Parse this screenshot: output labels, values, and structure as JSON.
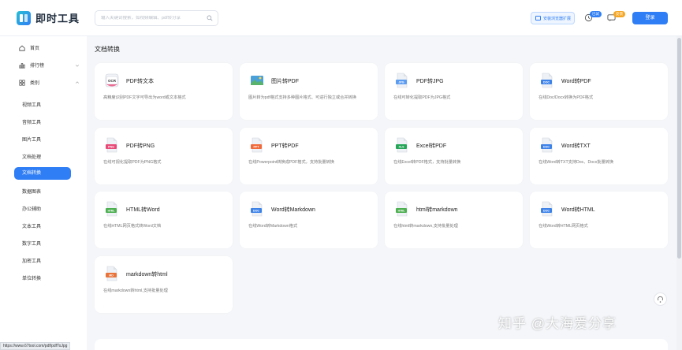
{
  "header": {
    "logo_text": "即时工具",
    "search_placeholder": "输入关键词搜索，如视频编辑、pdf转分享",
    "ext_button": "安装浏览器扩展",
    "badge_1": "已试",
    "badge_2": "反馈",
    "login": "登录"
  },
  "sidebar": {
    "home": "首页",
    "ranking": "排行榜",
    "categories": "类别",
    "sub": [
      "视频工具",
      "音频工具",
      "图片工具",
      "文档处理",
      "文档转换",
      "数据图表",
      "办公辅助",
      "文本工具",
      "数字工具",
      "加密工具",
      "单位转换"
    ],
    "active_index": 4
  },
  "section": {
    "title": "文档转换"
  },
  "cards": [
    {
      "title": "PDF转文本",
      "desc": "高精度识别PDF文字可导出为word或文本格式",
      "icon": "ocr"
    },
    {
      "title": "图片转PDF",
      "desc": "图片转为pdf格式支持多种图片格式、可进行独立或合并转换",
      "icon": "image"
    },
    {
      "title": "PDF转JPG",
      "desc": "在线可转化提取PDF为JPG格式",
      "icon": "JPG"
    },
    {
      "title": "Word转PDF",
      "desc": "在线Doc/Docx转换为PDF格式",
      "icon": "DOC"
    },
    {
      "title": "PDF转PNG",
      "desc": "在线可视化提取PDF为PNG格式",
      "icon": "PNG"
    },
    {
      "title": "PPT转PDF",
      "desc": "在线Powerpoint转换成PDF格式，支持批量转换",
      "icon": "PPT"
    },
    {
      "title": "Excel转PDF",
      "desc": "在线Excel转PDF格式，支持批量转换",
      "icon": "XLS"
    },
    {
      "title": "Word转TXT",
      "desc": "在线Word转TXT支持Doc、Docx批量转换",
      "icon": "DOC"
    },
    {
      "title": "HTML转Word",
      "desc": "在线HTML网页格式转Word文档",
      "icon": "HTML"
    },
    {
      "title": "Word转Markdown",
      "desc": "在线Word转Markdown格式",
      "icon": "DOC"
    },
    {
      "title": "html转markdown",
      "desc": "在线html转markdown,支持批量处理",
      "icon": "HTML"
    },
    {
      "title": "Word转HTML",
      "desc": "在线Word转HTML网页格式",
      "icon": "DOC"
    },
    {
      "title": "markdown转html",
      "desc": "在线markdown转html,支持批量处理",
      "icon": "MD"
    }
  ],
  "status_url": "https://www.67tool.com/pdf/pdfToJpg",
  "watermark": "知乎 @大海爱分享",
  "colors": {
    "accent": "#2f7ef5",
    "jpg": "#5b9bf0",
    "doc": "#3d82e8",
    "png": "#e84a78",
    "ppt": "#f06a3c",
    "xls": "#25a558",
    "html": "#4caf50",
    "md": "#e8743c"
  }
}
